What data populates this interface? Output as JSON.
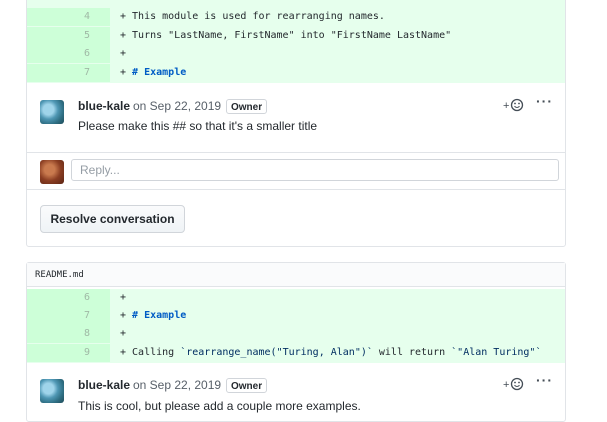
{
  "top_diff": {
    "lines": [
      {
        "num": "4",
        "text": "+ This module is used for rearranging names."
      },
      {
        "num": "5",
        "text": "+ Turns \"LastName, FirstName\" into \"FirstName LastName\""
      },
      {
        "num": "6",
        "text": "+"
      },
      {
        "num": "7",
        "prefix": "+ ",
        "heading": "# Example"
      }
    ]
  },
  "thread_one": {
    "comment": {
      "author": "blue-kale",
      "date": "on Sep 22, 2019",
      "badge": "Owner",
      "body": "Please make this ## so that it's a smaller title"
    },
    "reply_placeholder": "Reply...",
    "resolve_label": "Resolve conversation"
  },
  "second_file": {
    "filename": "README.md",
    "lines": [
      {
        "num": "6",
        "text": "+"
      },
      {
        "num": "7",
        "prefix": "+ ",
        "heading": "# Example"
      },
      {
        "num": "8",
        "text": "+"
      },
      {
        "num": "9",
        "prefix": "+ Calling ",
        "code1": "`rearrange_name(\"Turing, Alan\")`",
        "mid": " will return ",
        "code2": "`\"Alan Turing\"`"
      }
    ],
    "comment": {
      "author": "blue-kale",
      "date": "on Sep 22, 2019",
      "badge": "Owner",
      "body": "This is cool, but please add a couple more examples."
    }
  },
  "icons": {
    "reaction": "smiley-plus-icon",
    "more": "kebab-horizontal-icon"
  },
  "colors": {
    "added_line_bg": "#e6ffed",
    "added_gutter_bg": "#cdffd8",
    "heading": "#005cc5",
    "border": "#e1e4e8"
  }
}
